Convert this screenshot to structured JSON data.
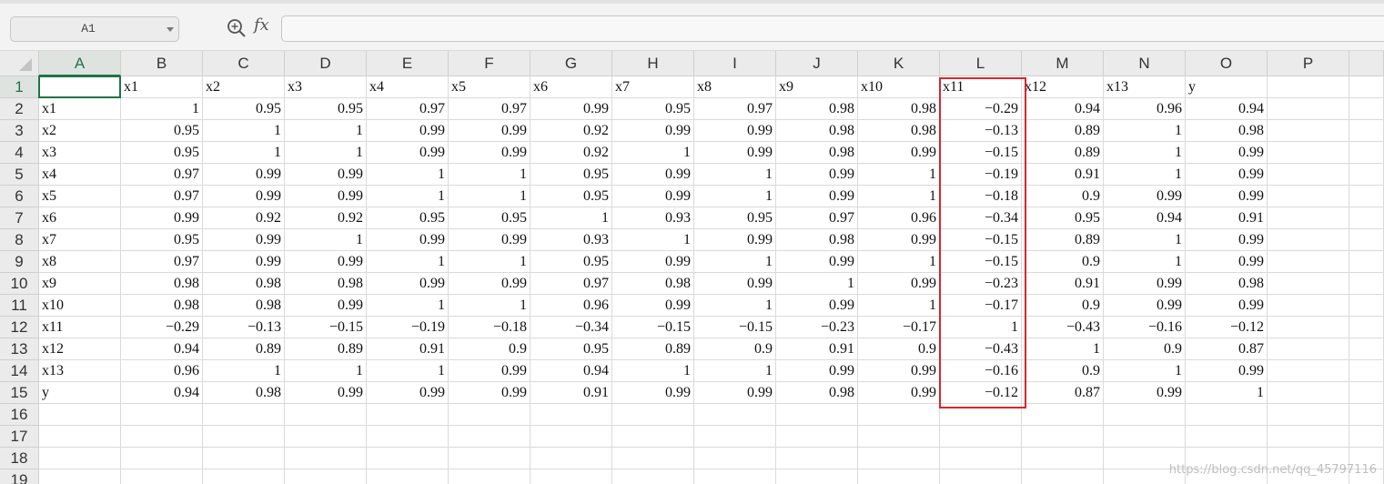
{
  "toolbar": {
    "name_box_value": "A1",
    "zoom_icon": "zoom-search-icon",
    "fx_label": "fx",
    "formula_value": ""
  },
  "sheet": {
    "columns": [
      "A",
      "B",
      "C",
      "D",
      "E",
      "F",
      "G",
      "H",
      "I",
      "J",
      "K",
      "L",
      "M",
      "N",
      "O",
      "P"
    ],
    "rows": [
      [
        "",
        "x1",
        "x2",
        "x3",
        "x4",
        "x5",
        "x6",
        "x7",
        "x8",
        "x9",
        "x10",
        "x11",
        "x12",
        "x13",
        "y"
      ],
      [
        "x1",
        "1",
        "0.95",
        "0.95",
        "0.97",
        "0.97",
        "0.99",
        "0.95",
        "0.97",
        "0.98",
        "0.98",
        "-0.29",
        "0.94",
        "0.96",
        "0.94"
      ],
      [
        "x2",
        "0.95",
        "1",
        "1",
        "0.99",
        "0.99",
        "0.92",
        "0.99",
        "0.99",
        "0.98",
        "0.98",
        "-0.13",
        "0.89",
        "1",
        "0.98"
      ],
      [
        "x3",
        "0.95",
        "1",
        "1",
        "0.99",
        "0.99",
        "0.92",
        "1",
        "0.99",
        "0.98",
        "0.99",
        "-0.15",
        "0.89",
        "1",
        "0.99"
      ],
      [
        "x4",
        "0.97",
        "0.99",
        "0.99",
        "1",
        "1",
        "0.95",
        "0.99",
        "1",
        "0.99",
        "1",
        "-0.19",
        "0.91",
        "1",
        "0.99"
      ],
      [
        "x5",
        "0.97",
        "0.99",
        "0.99",
        "1",
        "1",
        "0.95",
        "0.99",
        "1",
        "0.99",
        "1",
        "-0.18",
        "0.9",
        "0.99",
        "0.99"
      ],
      [
        "x6",
        "0.99",
        "0.92",
        "0.92",
        "0.95",
        "0.95",
        "1",
        "0.93",
        "0.95",
        "0.97",
        "0.96",
        "-0.34",
        "0.95",
        "0.94",
        "0.91"
      ],
      [
        "x7",
        "0.95",
        "0.99",
        "1",
        "0.99",
        "0.99",
        "0.93",
        "1",
        "0.99",
        "0.98",
        "0.99",
        "-0.15",
        "0.89",
        "1",
        "0.99"
      ],
      [
        "x8",
        "0.97",
        "0.99",
        "0.99",
        "1",
        "1",
        "0.95",
        "0.99",
        "1",
        "0.99",
        "1",
        "-0.15",
        "0.9",
        "1",
        "0.99"
      ],
      [
        "x9",
        "0.98",
        "0.98",
        "0.98",
        "0.99",
        "0.99",
        "0.97",
        "0.98",
        "0.99",
        "1",
        "0.99",
        "-0.23",
        "0.91",
        "0.99",
        "0.98"
      ],
      [
        "x10",
        "0.98",
        "0.98",
        "0.99",
        "1",
        "1",
        "0.96",
        "0.99",
        "1",
        "0.99",
        "1",
        "-0.17",
        "0.9",
        "0.99",
        "0.99"
      ],
      [
        "x11",
        "-0.29",
        "-0.13",
        "-0.15",
        "-0.19",
        "-0.18",
        "-0.34",
        "-0.15",
        "-0.15",
        "-0.23",
        "-0.17",
        "1",
        "-0.43",
        "-0.16",
        "-0.12"
      ],
      [
        "x12",
        "0.94",
        "0.89",
        "0.89",
        "0.91",
        "0.9",
        "0.95",
        "0.89",
        "0.9",
        "0.91",
        "0.9",
        "-0.43",
        "1",
        "0.9",
        "0.87"
      ],
      [
        "x13",
        "0.96",
        "1",
        "1",
        "1",
        "0.99",
        "0.94",
        "1",
        "1",
        "0.99",
        "0.99",
        "-0.16",
        "0.9",
        "1",
        "0.99"
      ],
      [
        "y",
        "0.94",
        "0.98",
        "0.99",
        "0.99",
        "0.99",
        "0.91",
        "0.99",
        "0.99",
        "0.98",
        "0.99",
        "-0.12",
        "0.87",
        "0.99",
        "1"
      ],
      [],
      [],
      [],
      []
    ],
    "row_labels": [
      "1",
      "2",
      "3",
      "4",
      "5",
      "6",
      "7",
      "8",
      "9",
      "10",
      "11",
      "12",
      "13",
      "14",
      "15",
      "16",
      "17",
      "18",
      "19"
    ],
    "selected_cell": "A1",
    "highlighted_column": "L",
    "colors": {
      "selection": "#217346",
      "highlight": "#d9262a"
    }
  },
  "watermark": "https://blog.csdn.net/qq_45797116"
}
